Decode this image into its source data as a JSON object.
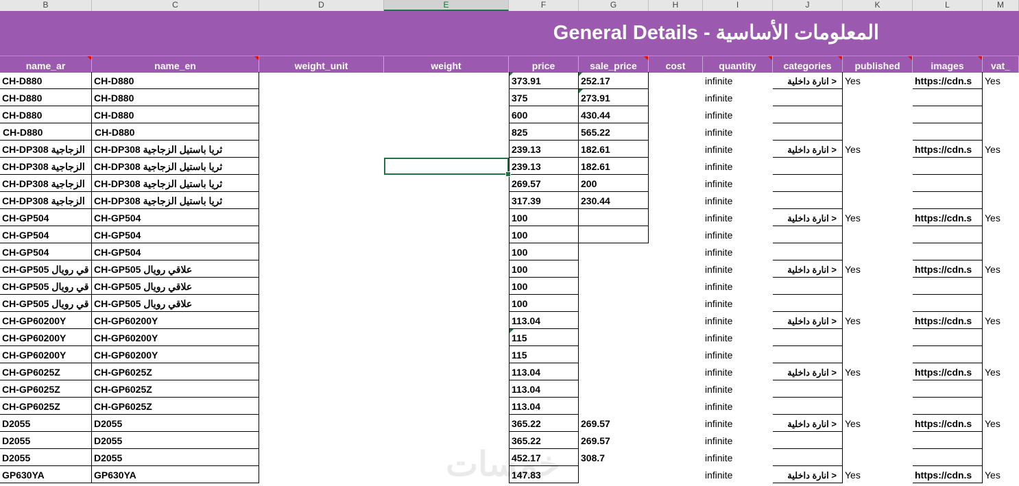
{
  "column_letters": [
    "B",
    "C",
    "D",
    "E",
    "F",
    "G",
    "H",
    "I",
    "J",
    "K",
    "L",
    "M"
  ],
  "banner_title": "General Details - المعلومات الأساسية",
  "headers": [
    "name_ar",
    "name_en",
    "weight_unit",
    "weight",
    "price",
    "sale_price",
    "cost",
    "quantity",
    "categories",
    "published",
    "images",
    "vat_"
  ],
  "category_text": "انارة داخلية >",
  "rows": [
    {
      "name_ar": "CH-D880",
      "name_en": "CH-D880",
      "price": "373.91",
      "sale": "252.17",
      "qty": "infinite",
      "cat": true,
      "pub": "Yes",
      "img": "https://cdn.s",
      "vat": "Yes"
    },
    {
      "name_ar": "CH-D880",
      "name_en": "CH-D880",
      "price": "375",
      "sale": "273.91",
      "qty": "infinite"
    },
    {
      "name_ar": "CH-D880",
      "name_en": "CH-D880",
      "price": "600",
      "sale": "430.44",
      "qty": "infinite"
    },
    {
      "name_ar": "CH-D880",
      "name_en": "CH-D880",
      "price": "825",
      "sale": "565.22",
      "qty": "infinite",
      "big": true
    },
    {
      "name_ar": "CH-DP308 الزجاجية",
      "name_en": "CH-DP308 ثريا باستيل الزجاجية",
      "price": "239.13",
      "sale": "182.61",
      "qty": "infinite",
      "cat": true,
      "pub": "Yes",
      "img": "https://cdn.s",
      "vat": "Yes"
    },
    {
      "name_ar": "CH-DP308 الزجاجية",
      "name_en": "CH-DP308 ثريا باستيل الزجاجية",
      "price": "239.13",
      "sale": "182.61",
      "qty": "infinite"
    },
    {
      "name_ar": "CH-DP308 الزجاجية",
      "name_en": "CH-DP308 ثريا باستيل الزجاجية",
      "price": "269.57",
      "sale": "200",
      "qty": "infinite"
    },
    {
      "name_ar": "CH-DP308 الزجاجية",
      "name_en": "CH-DP308 ثريا باستيل الزجاجية",
      "price": "317.39",
      "sale": "230.44",
      "qty": "infinite"
    },
    {
      "name_ar": "CH-GP504",
      "name_en": "CH-GP504",
      "price": "100",
      "sale": "",
      "qty": "infinite",
      "cat": true,
      "pub": "Yes",
      "img": "https://cdn.s",
      "vat": "Yes"
    },
    {
      "name_ar": "CH-GP504",
      "name_en": "CH-GP504",
      "price": "100",
      "sale": "",
      "qty": "infinite"
    },
    {
      "name_ar": "CH-GP504",
      "name_en": "CH-GP504",
      "price": "100",
      "qty": "infinite"
    },
    {
      "name_ar": "CH-GP505 قي رويال",
      "name_en": "CH-GP505 علاقي رويال",
      "price": "100",
      "qty": "infinite",
      "cat": true,
      "pub": "Yes",
      "img": "https://cdn.s",
      "vat": "Yes"
    },
    {
      "name_ar": "CH-GP505 قي رويال",
      "name_en": "CH-GP505 علاقي رويال",
      "price": "100",
      "qty": "infinite"
    },
    {
      "name_ar": "CH-GP505 قي رويال",
      "name_en": "CH-GP505 علاقي رويال",
      "price": "100",
      "qty": "infinite"
    },
    {
      "name_ar": "CH-GP60200Y",
      "name_en": "CH-GP60200Y",
      "price": "113.04",
      "qty": "infinite",
      "cat": true,
      "pub": "Yes",
      "img": "https://cdn.s",
      "vat": "Yes"
    },
    {
      "name_ar": "CH-GP60200Y",
      "name_en": "CH-GP60200Y",
      "price": "115",
      "qty": "infinite"
    },
    {
      "name_ar": "CH-GP60200Y",
      "name_en": "CH-GP60200Y",
      "price": "115",
      "qty": "infinite"
    },
    {
      "name_ar": "CH-GP6025Z",
      "name_en": "CH-GP6025Z",
      "price": "113.04",
      "qty": "infinite",
      "cat": true,
      "pub": "Yes",
      "img": "https://cdn.s",
      "vat": "Yes"
    },
    {
      "name_ar": "CH-GP6025Z",
      "name_en": "CH-GP6025Z",
      "price": "113.04",
      "qty": "infinite"
    },
    {
      "name_ar": "CH-GP6025Z",
      "name_en": "CH-GP6025Z",
      "price": "113.04",
      "qty": "infinite"
    },
    {
      "name_ar": "D2055",
      "name_en": "D2055",
      "price": "365.22",
      "sale": "269.57",
      "qty": "infinite",
      "cat": true,
      "pub": "Yes",
      "img": "https://cdn.s",
      "vat": "Yes"
    },
    {
      "name_ar": "D2055",
      "name_en": "D2055",
      "price": "365.22",
      "sale": "269.57",
      "qty": "infinite"
    },
    {
      "name_ar": "D2055",
      "name_en": "D2055",
      "price": "452.17",
      "sale": "308.7",
      "qty": "infinite"
    },
    {
      "name_ar": "GP630YA",
      "name_en": "GP630YA",
      "price": "147.83",
      "qty": "infinite",
      "cat": true,
      "pub": "Yes",
      "img": "https://cdn.s",
      "vat": "Yes"
    }
  ],
  "watermark": "خمسات"
}
